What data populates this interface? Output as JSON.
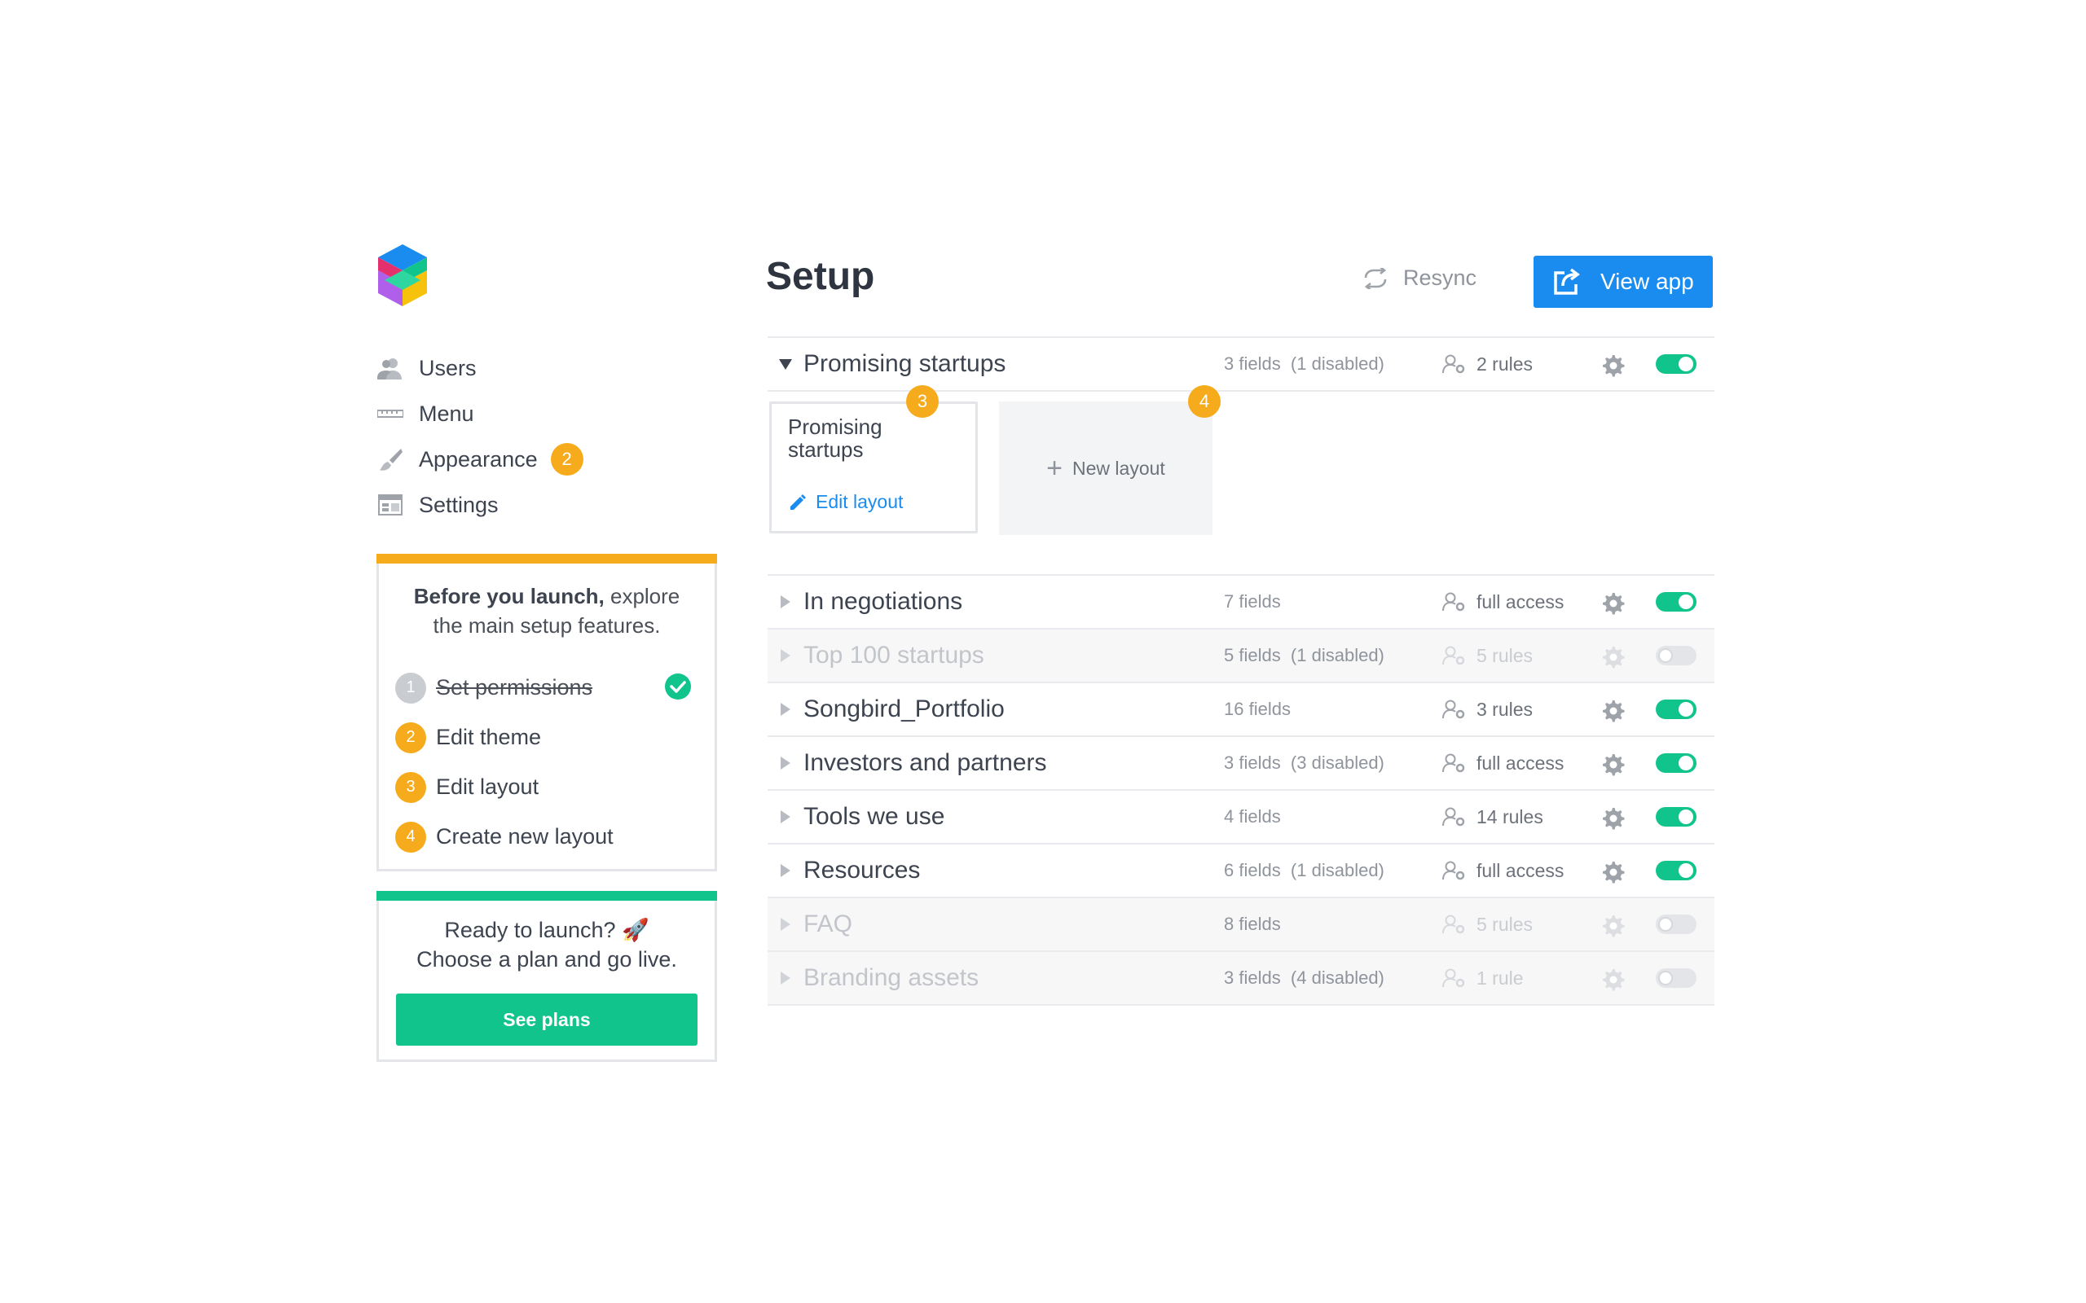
{
  "colors": {
    "accent_blue": "#1a8cf0",
    "accent_green": "#10c48b",
    "accent_orange": "#f6ab1c",
    "text_dark": "#3d4450",
    "text_muted": "#8f949c"
  },
  "sidebar": {
    "logo_icon": "stacked-cubes-logo",
    "nav": [
      {
        "label": "Users",
        "icon": "users-icon"
      },
      {
        "label": "Menu",
        "icon": "menu-icon"
      },
      {
        "label": "Appearance",
        "icon": "brush-icon",
        "badge": "2"
      },
      {
        "label": "Settings",
        "icon": "settings-panel-icon"
      }
    ],
    "launch_card": {
      "intro_bold": "Before you launch,",
      "intro_rest": " explore the main setup features.",
      "steps": [
        {
          "num": "1",
          "label": "Set permissions",
          "done": true
        },
        {
          "num": "2",
          "label": "Edit theme",
          "done": false
        },
        {
          "num": "3",
          "label": "Edit layout",
          "done": false
        },
        {
          "num": "4",
          "label": "Create new layout",
          "done": false
        }
      ]
    },
    "plan_card": {
      "line1": "Ready to launch? 🚀",
      "line2": "Choose a plan and go live.",
      "button": "See plans"
    }
  },
  "header": {
    "title": "Setup",
    "resync": "Resync",
    "view_app": "View app"
  },
  "expanded_table": {
    "name": "Promising startups",
    "fields": "3 fields  (1 disabled)",
    "access": "2 rules",
    "enabled": true,
    "layout_card": {
      "title": "Promising startups",
      "edit": "Edit layout",
      "badge": "3"
    },
    "new_layout": {
      "label": "New layout",
      "badge": "4"
    }
  },
  "tables": [
    {
      "name": "In negotiations",
      "fields": "7 fields",
      "access": "full access",
      "enabled": true
    },
    {
      "name": "Top 100 startups",
      "fields": "5 fields  (1 disabled)",
      "access": "5 rules",
      "enabled": false
    },
    {
      "name": "Songbird_Portfolio",
      "fields": "16 fields",
      "access": "3 rules",
      "enabled": true
    },
    {
      "name": "Investors and partners",
      "fields": "3 fields  (3 disabled)",
      "access": "full access",
      "enabled": true
    },
    {
      "name": "Tools we use",
      "fields": "4 fields",
      "access": "14 rules",
      "enabled": true
    },
    {
      "name": "Resources",
      "fields": "6 fields  (1 disabled)",
      "access": "full access",
      "enabled": true
    },
    {
      "name": "FAQ",
      "fields": "8 fields",
      "access": "5 rules",
      "enabled": false
    },
    {
      "name": "Branding assets",
      "fields": "3 fields  (4 disabled)",
      "access": "1 rule",
      "enabled": false
    }
  ]
}
